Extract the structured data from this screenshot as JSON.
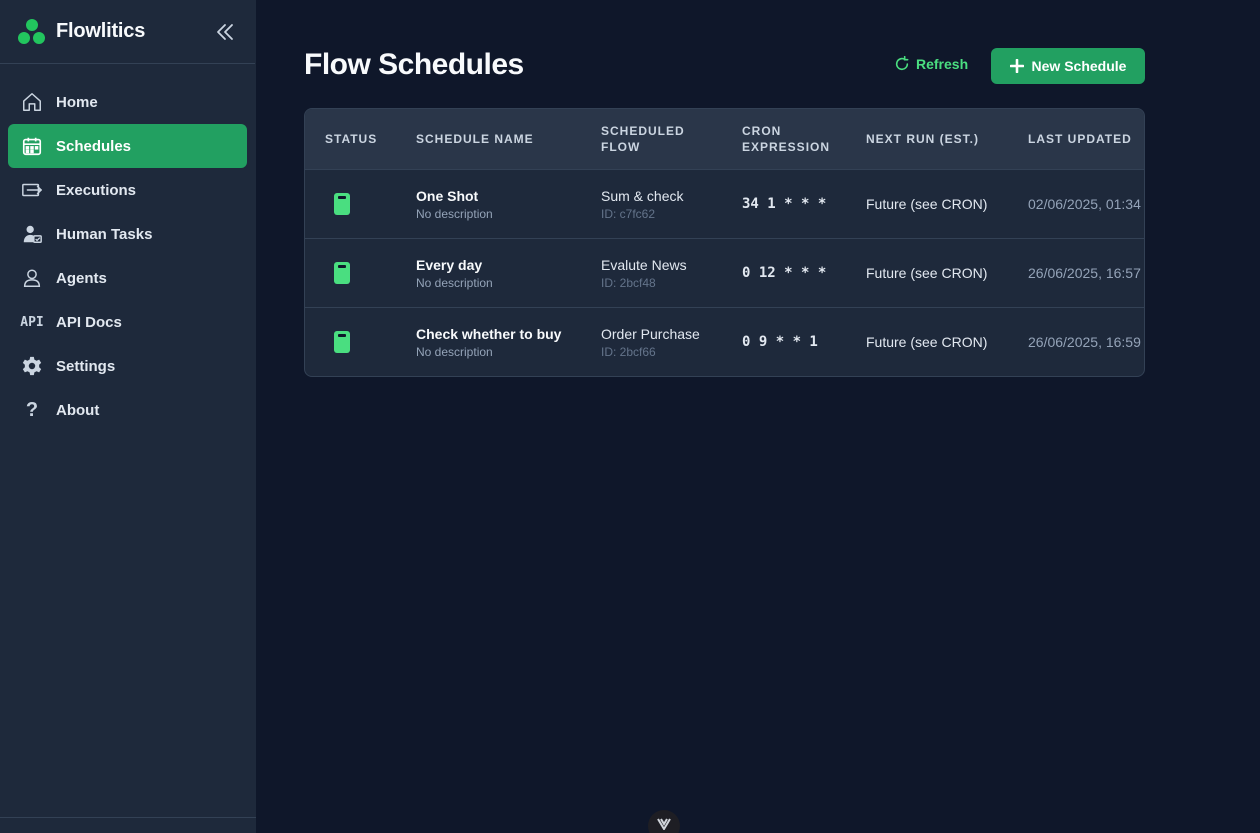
{
  "brand": {
    "name": "Flowlitics"
  },
  "sidebar": {
    "items": [
      {
        "label": "Home",
        "icon": "home-icon",
        "active": false
      },
      {
        "label": "Schedules",
        "icon": "calendar-icon",
        "active": true
      },
      {
        "label": "Executions",
        "icon": "executions-icon",
        "active": false
      },
      {
        "label": "Human Tasks",
        "icon": "user-check-icon",
        "active": false
      },
      {
        "label": "Agents",
        "icon": "user-icon",
        "active": false
      },
      {
        "label": "API Docs",
        "icon": "api-icon",
        "icon_text": "API",
        "active": false
      },
      {
        "label": "Settings",
        "icon": "gear-icon",
        "active": false
      },
      {
        "label": "About",
        "icon": "question-icon",
        "icon_text": "?",
        "active": false
      }
    ]
  },
  "header": {
    "title": "Flow Schedules",
    "refresh_label": "Refresh",
    "new_label": "New Schedule"
  },
  "table": {
    "columns": [
      "Status",
      "Schedule Name",
      "Scheduled Flow",
      "Cron Expression",
      "Next Run (est.)",
      "Last Updated"
    ],
    "rows": [
      {
        "status": "active",
        "name": "One Shot",
        "description": "No description",
        "flow": "Sum & check",
        "flow_id": "ID: c7fc62",
        "cron": "34 1 * * *",
        "next_run": "Future (see CRON)",
        "last_updated": "02/06/2025, 01:34"
      },
      {
        "status": "active",
        "name": "Every day",
        "description": "No description",
        "flow": "Evalute News",
        "flow_id": "ID: 2bcf48",
        "cron": "0 12 * * *",
        "next_run": "Future (see CRON)",
        "last_updated": "26/06/2025, 16:57"
      },
      {
        "status": "active",
        "name": "Check whether to buy",
        "description": "No description",
        "flow": "Order Purchase",
        "flow_id": "ID: 2bcf66",
        "cron": "0 9 * * 1",
        "next_run": "Future (see CRON)",
        "last_updated": "26/06/2025, 16:59"
      }
    ]
  },
  "colors": {
    "accent": "#22a061",
    "status": "#4ade80",
    "bg": "#0f172a",
    "panel": "#1e293b"
  }
}
